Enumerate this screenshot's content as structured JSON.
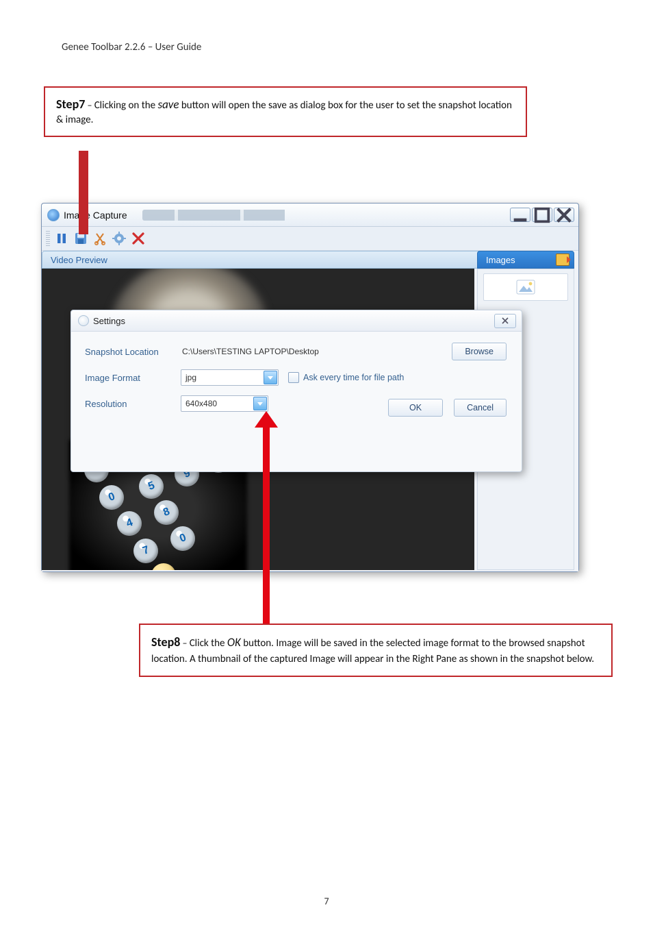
{
  "doc": {
    "header": "Genee Toolbar 2.2.6 – User Guide",
    "page_number": "7"
  },
  "step7": {
    "label": "Step7",
    "dash": " –",
    "pre": "Clicking on the ",
    "italic": "save",
    "post": " button will open the save as dialog box for the user to set the snapshot location & image."
  },
  "window": {
    "title": "Image Capture",
    "tabs": {
      "video": "Video Preview",
      "images": "Images"
    }
  },
  "settings": {
    "title": "Settings",
    "snapshot_label": "Snapshot Location",
    "snapshot_path": "C:\\Users\\TESTING LAPTOP\\Desktop",
    "browse_label": "Browse",
    "format_label": "Image Format",
    "format_value": "jpg",
    "ask_label": "Ask every time for file path",
    "resolution_label": "Resolution",
    "resolution_value": "640x480",
    "ok_label": "OK",
    "cancel_label": "Cancel"
  },
  "step8": {
    "label": "Step8",
    "dash": " –",
    "pre": "Click the ",
    "italic": "OK",
    "post": " button. Image will be saved in the selected image format to the browsed snapshot location. A thumbnail of the captured Image will appear in the Right Pane as shown in the snapshot below."
  }
}
